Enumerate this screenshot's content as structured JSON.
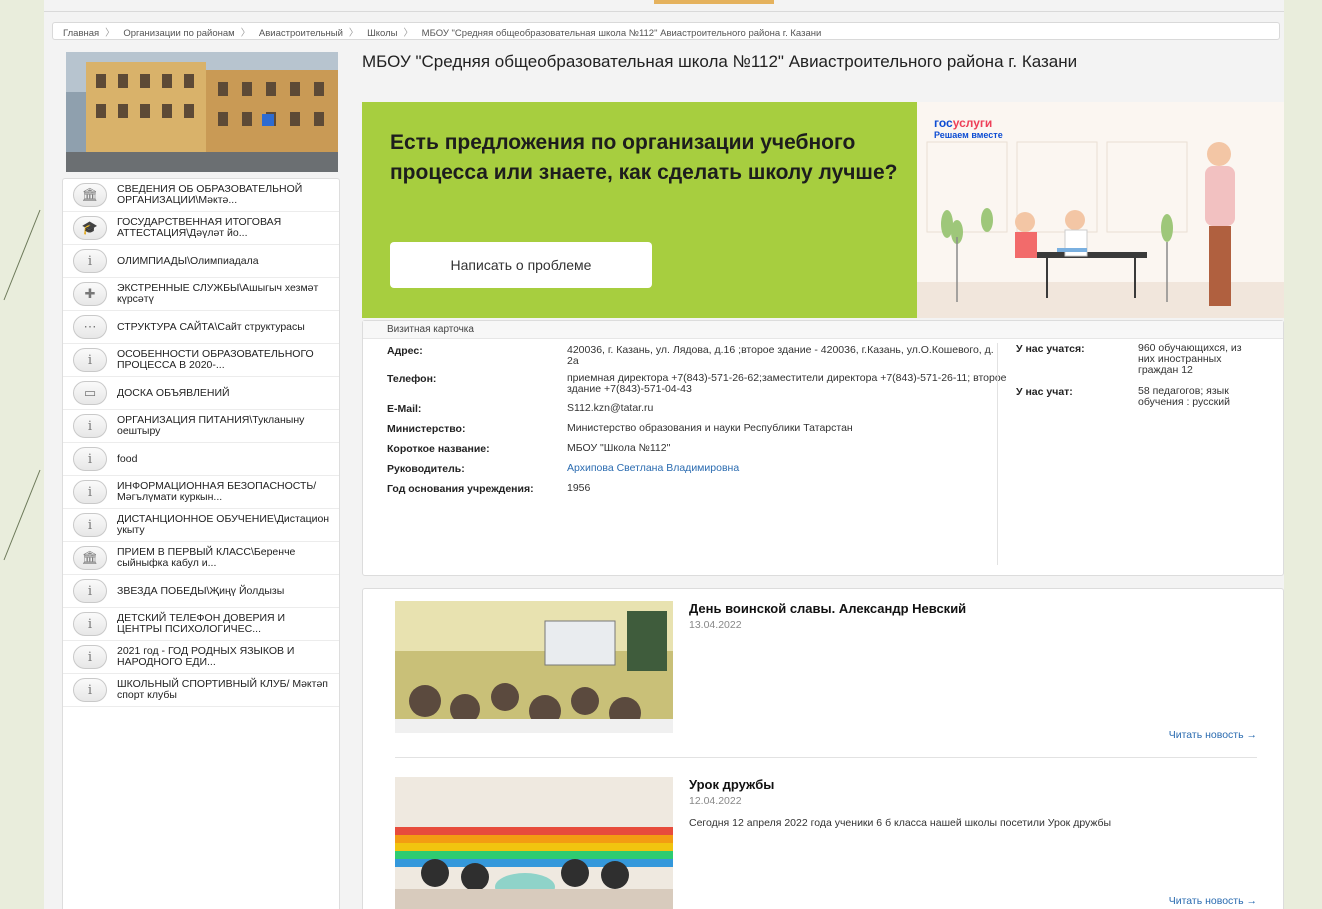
{
  "breadcrumb": {
    "items": [
      "Главная",
      "Организации по районам",
      "Авиастроительный",
      "Школы",
      "МБОУ \"Средняя общеобразовательная школа №112\" Авиастроительного района г. Казани"
    ]
  },
  "school": {
    "title": "МБОУ \"Средняя общеобразовательная школа №112\" Авиастроительного района г. Казани"
  },
  "sidebar": {
    "items": [
      {
        "label": "СВЕДЕНИЯ ОБ ОБРАЗОВАТЕЛЬНОЙ ОРГАНИЗАЦИИ\\Мәктә...",
        "icon": "building-icon"
      },
      {
        "label": "ГОСУДАРСТВЕННАЯ ИТОГОВАЯ АТТЕСТАЦИЯ\\Дәүләт йо...",
        "icon": "graduation-cap-icon"
      },
      {
        "label": "ОЛИМПИАДЫ\\Олимпиадала",
        "icon": "info-icon"
      },
      {
        "label": "ЭКСТРЕННЫЕ СЛУЖБЫ\\Ашыгыч хезмәт күрсәтү",
        "icon": "medical-cross-icon"
      },
      {
        "label": "СТРУКТУРА САЙТА\\Сайт структурасы",
        "icon": "sitemap-icon"
      },
      {
        "label": "ОСОБЕННОСТИ ОБРАЗОВАТЕЛЬНОГО ПРОЦЕССА В 2020-...",
        "icon": "info-icon"
      },
      {
        "label": "ДОСКА ОБЪЯВЛЕНИЙ",
        "icon": "board-icon"
      },
      {
        "label": "ОРГАНИЗАЦИЯ ПИТАНИЯ\\Тукланыну оештыру",
        "icon": "info-icon"
      },
      {
        "label": "food",
        "icon": "info-icon"
      },
      {
        "label": "ИНФОРМАЦИОННАЯ БЕЗОПАСНОСТЬ/ Мәгълүмати куркын...",
        "icon": "info-icon"
      },
      {
        "label": "ДИСТАНЦИОННОЕ ОБУЧЕНИЕ\\Дистацион укыту",
        "icon": "info-icon"
      },
      {
        "label": "ПРИЕМ В ПЕРВЫЙ КЛАСС\\Беренче сыйныфка кабул и...",
        "icon": "building-icon"
      },
      {
        "label": "ЗВЕЗДА ПОБЕДЫ\\Җиңү Йолдызы",
        "icon": "info-icon"
      },
      {
        "label": "ДЕТСКИЙ ТЕЛЕФОН ДОВЕРИЯ И ЦЕНТРЫ ПСИХОЛОГИЧЕС...",
        "icon": "info-icon"
      },
      {
        "label": "2021 год - ГОД РОДНЫХ ЯЗЫКОВ И НАРОДНОГО ЕДИ...",
        "icon": "info-icon"
      },
      {
        "label": "ШКОЛЬНЫЙ СПОРТИВНЫЙ КЛУБ/ Мәктәп спорт клубы",
        "icon": "info-icon"
      }
    ]
  },
  "banner": {
    "headline": "Есть предложения по организации учебного процесса или знаете, как сделать школу лучше?",
    "button_label": "Написать о проблеме",
    "logo_part1": "гос",
    "logo_part2": "услуги",
    "logo_tagline": "Решаем вместе",
    "green": "#a7ce3f"
  },
  "card": {
    "header": "Визитная карточка",
    "rows": [
      {
        "key": "Адрес:",
        "value": "420036, г. Казань, ул. Лядова, д.16 ;второе здание - 420036, г.Казань, ул.О.Кошевого, д. 2а"
      },
      {
        "key": "Телефон:",
        "value": "приемная директора +7(843)-571-26-62;заместители директора +7(843)-571-26-11; второе здание +7(843)-571-04-43"
      },
      {
        "key": "E-Mail:",
        "value": "S112.kzn@tatar.ru"
      },
      {
        "key": "Министерство:",
        "value": "Министерство образования и науки Республики Татарстан"
      },
      {
        "key": "Короткое название:",
        "value": "МБОУ \"Школа №112\""
      },
      {
        "key": "Руководитель:",
        "value": "Архипова Светлана Владимировна"
      },
      {
        "key": "Год основания учреждения:",
        "value": "1956"
      }
    ],
    "side": [
      {
        "key": "У нас учатся:",
        "value": "960 обучающихся, из них иностранных граждан 12"
      },
      {
        "key": "У нас учат:",
        "value": "58 педагогов; язык обучения : русский"
      }
    ]
  },
  "news": {
    "items": [
      {
        "title": "День воинской славы. Александр Невский",
        "date": "13.04.2022",
        "text": "",
        "more": "Читать новость →"
      },
      {
        "title": "Урок дружбы",
        "date": "12.04.2022",
        "text": "Сегодня 12 апреля 2022 года ученики 6 б класса нашей школы посетили Урок дружбы",
        "more": "Читать новость →"
      }
    ]
  }
}
